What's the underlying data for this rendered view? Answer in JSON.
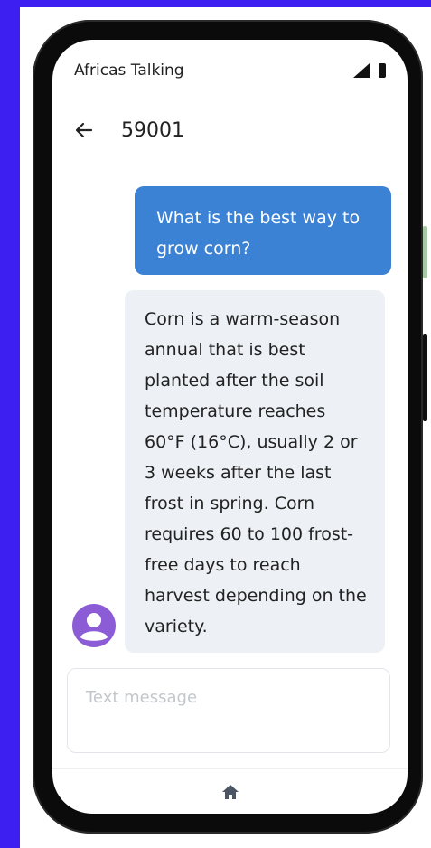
{
  "status_bar": {
    "title": "Africas Talking",
    "signal_icon": "cellular-signal-icon",
    "battery_icon": "battery-icon"
  },
  "header": {
    "back_icon": "arrow-left-icon",
    "title": "59001"
  },
  "messages": [
    {
      "direction": "outgoing",
      "text": "What is the best way to grow corn?"
    },
    {
      "direction": "incoming",
      "text": "Corn is a warm-season annual that is best planted after the soil temperature reaches 60°F (16°C), usually 2 or 3 weeks after the last frost in spring. Corn requires 60 to 100 frost-free days to reach harvest depending on the variety."
    }
  ],
  "composer": {
    "placeholder": "Text message",
    "value": ""
  },
  "bottom_nav": {
    "home_icon": "home-icon"
  },
  "colors": {
    "page_background": "#3d1ff1",
    "outgoing_bubble": "#3b82d4",
    "incoming_bubble": "#edf1f5",
    "avatar": "#8b5cd6"
  }
}
